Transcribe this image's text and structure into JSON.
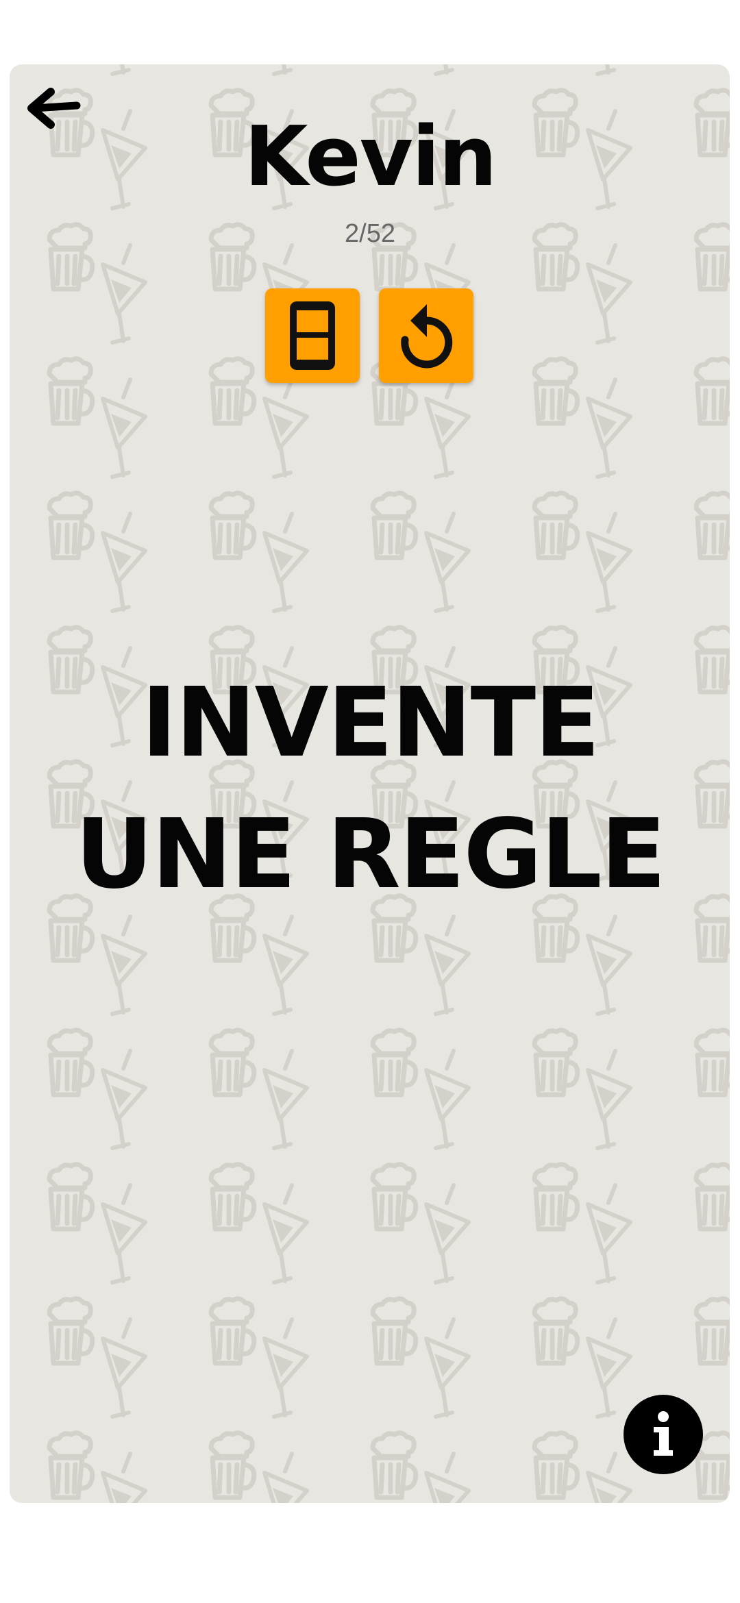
{
  "header": {
    "back_icon": "arrow-left-icon",
    "player_name": "Kevin",
    "progress": "2/52"
  },
  "actions": {
    "phone_icon": "phone-icon",
    "restart_icon": "restart-icon",
    "accent_color": "#ffa000"
  },
  "card": {
    "text": "INVENTE UNE REGLE",
    "background_color": "#e8e6e1",
    "pattern_icons": [
      "beer-mug-icon",
      "cocktail-glass-icon"
    ]
  },
  "footer": {
    "info_icon": "info-icon"
  }
}
